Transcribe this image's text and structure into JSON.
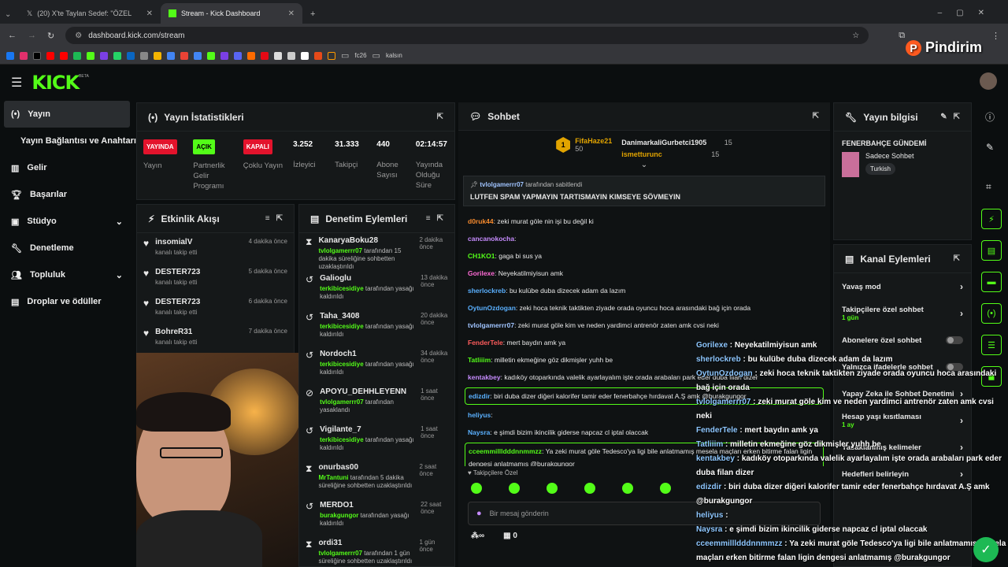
{
  "browser": {
    "tabs": [
      {
        "label": "(20) X'te Taylan Sedef: \"ÖZEL İ"
      },
      {
        "label": "Stream - Kick Dashboard"
      }
    ],
    "url": "dashboard.kick.com/stream",
    "bookmarks": [
      "fc26",
      "kalsın"
    ],
    "watermark": "Pindirim"
  },
  "app": {
    "logo": "KICK",
    "logo_badge": "BETA"
  },
  "sidebar": {
    "items": [
      {
        "label": "Yayın"
      },
      {
        "label": "Yayın Bağlantısı ve Anahtarı"
      },
      {
        "label": "Gelir"
      },
      {
        "label": "Başarılar"
      },
      {
        "label": "Stüdyo"
      },
      {
        "label": "Denetleme"
      },
      {
        "label": "Topluluk"
      },
      {
        "label": "Droplar ve ödüller"
      }
    ]
  },
  "stats": {
    "title": "Yayın İstatistikleri",
    "items": [
      {
        "badge": "YAYINDA",
        "label": "Yayın"
      },
      {
        "badge": "AÇIK",
        "label": "Partnerlik Gelir Programı"
      },
      {
        "badge": "KAPALI",
        "label": "Çoklu Yayın"
      },
      {
        "value": "3.252",
        "label": "İzleyici"
      },
      {
        "value": "31.333",
        "label": "Takipçi"
      },
      {
        "value": "440",
        "label": "Abone Sayısı"
      },
      {
        "value": "02:14:57",
        "label": "Yayında Olduğu Süre"
      }
    ]
  },
  "activity": {
    "title": "Etkinlik Akışı",
    "items": [
      {
        "name": "insomialV",
        "sub": "kanalı takip etti",
        "time": "4 dakika önce"
      },
      {
        "name": "DESTER723",
        "sub": "kanalı takip etti",
        "time": "5 dakika önce"
      },
      {
        "name": "DESTER723",
        "sub": "kanalı takip etti",
        "time": "6 dakika önce"
      },
      {
        "name": "BohreR31",
        "sub": "kanalı takip etti",
        "time": "7 dakika önce"
      }
    ]
  },
  "moderation": {
    "title": "Denetim Eylemleri",
    "items": [
      {
        "name": "KanaryaBoku28",
        "by": "tvlolgamerrr07",
        "rest": "tarafından 15 dakika süreliğine sohbetten uzaklaştırıldı",
        "time": "2 dakika önce"
      },
      {
        "name": "Galioglu",
        "by": "terkibicesidiye",
        "rest": "tarafından yasağı kaldırıldı",
        "time": "13 dakika önce"
      },
      {
        "name": "Taha_3408",
        "by": "terkibicesidiye",
        "rest": "tarafından yasağı kaldırıldı",
        "time": "20 dakika önce"
      },
      {
        "name": "Nordoch1",
        "by": "terkibicesidiye",
        "rest": "tarafından yasağı kaldırıldı",
        "time": "34 dakika önce"
      },
      {
        "name": "APOYU_DEHHLEYENN",
        "by": "tvlolgamerrr07",
        "rest": "tarafından yasaklandı",
        "time": "1 saat önce"
      },
      {
        "name": "Vigilante_7",
        "by": "terkibicesidiye",
        "rest": "tarafından yasağı kaldırıldı",
        "time": "1 saat önce"
      },
      {
        "name": "onurbas00",
        "by": "MrTantuni",
        "rest": "tarafından 5 dakika süreliğine sohbetten uzaklaştırıldı",
        "time": "2 saat önce"
      },
      {
        "name": "MERDO1",
        "by": "burakgungor",
        "rest": "tarafından yasağı kaldırıldı",
        "time": "22 saat önce"
      },
      {
        "name": "ordi31",
        "by": "tvlolgamerrr07",
        "rest": "tarafından 1 gün süreliğine sohbetten uzaklaştırıldı",
        "time": "1 gün önce"
      }
    ]
  },
  "chat": {
    "title": "Sohbet",
    "top": [
      {
        "name": "FifaHaze21",
        "value": "50"
      },
      {
        "name": "DanimarkaliGurbetci1905",
        "value": "15"
      },
      {
        "name": "ismetturunc",
        "value": "15"
      }
    ],
    "pinned": {
      "by": "tvlolgamerrr07",
      "suffix": "tarafından sabitlendi",
      "text": "LUTFEN SPAM YAPMAYIN TARTISMAYIN KIMSEYE SÖVMEYIN"
    },
    "messages": [
      {
        "user": "d0ruk44",
        "text": "zeki murat göle nin işi bu değil ki",
        "color": "#f58a2e"
      },
      {
        "user": "cancanokocha",
        "text": "",
        "color": "#c78cff"
      },
      {
        "user": "CH1KO1",
        "text": "gaga bi sus ya",
        "color": "#53fc18"
      },
      {
        "user": "Gorilexe",
        "text": "Neyekatilmiyisun amk",
        "color": "#ff6bd6"
      },
      {
        "user": "sherlockreb",
        "text": "bu kulübe duba dizecek adam da lazım",
        "color": "#5ab0ff"
      },
      {
        "user": "OytunOzdogan",
        "text": "zeki hoca teknik taktikten ziyade orada oyuncu hoca arasındaki bağ için orada",
        "color": "#5ab0ff"
      },
      {
        "user": "tvlolgamerrr07",
        "text": "zeki murat göle kim ve neden yardimci antrenör zaten amk cvsi neki",
        "color": "#a0c4ff"
      },
      {
        "user": "FenderTele",
        "text": "mert baydın amk ya",
        "color": "#ff5c5c"
      },
      {
        "user": "Tatliiim",
        "text": "milletin ekmeğine göz dikmişler yuhh be",
        "color": "#53fc18"
      },
      {
        "user": "kentakbey",
        "text": "kadıköy otoparkında valelik ayarlayalım işte orada arabaları park eder duba filan dizer",
        "color": "#c78cff"
      },
      {
        "user": "edizdir",
        "text": "biri duba dizer diğeri kalorifer tamir eder fenerbahçe hırdavat A.Ş amk @burakgungor",
        "color": "#5ab0ff"
      },
      {
        "user": "heliyus",
        "text": "",
        "color": "#5ab0ff"
      },
      {
        "user": "Naysra",
        "text": "e şimdi bizim ikincilik giderse napcaz cl iptal olaccak",
        "color": "#5ab0ff"
      },
      {
        "user": "cceemmillldddnnmmzz",
        "text": "Ya zeki murat göle Tedesco'ya ligi bile anlatmamış mesela maçları erken bitirme falan ligin dengesi anlatmamış @burakgungor",
        "color": "#53fc18"
      }
    ],
    "followers_label": "Takipçilere Özel",
    "input_placeholder": "Bir mesaj gönderin",
    "count": "0"
  },
  "overlay": {
    "messages": [
      {
        "user": "Gorilexe",
        "text": "Neyekatilmiyisun amk"
      },
      {
        "user": "sherlockreb",
        "text": "bu kulübe duba dizecek adam da lazım"
      },
      {
        "user": "OytunOzdogan",
        "text": "zeki hoca teknik taktikten ziyade orada oyuncu hoca arasındaki bağ için orada"
      },
      {
        "user": "tvlolgamerrr07",
        "text": "zeki murat göle kim ve neden yardimci antrenör zaten amk cvsi neki"
      },
      {
        "user": "FenderTele",
        "text": "mert baydın amk ya"
      },
      {
        "user": "Tatliiim",
        "text": "milletin ekmeğine göz dikmişler yuhh be"
      },
      {
        "user": "kentakbey",
        "text": "kadıköy otoparkında valelik ayarlayalım işte orada arabaları park eder duba filan dizer"
      },
      {
        "user": "edizdir",
        "text": "biri duba dizer diğeri kalorifer tamir eder fenerbahçe hırdavat A.Ş amk @burakgungor"
      },
      {
        "user": "heliyus",
        "text": ""
      },
      {
        "user": "Naysra",
        "text": "e şimdi bizim ikincilik giderse napcaz cl iptal olaccak"
      },
      {
        "user": "cceemmillldddnnmmzz",
        "text": "Ya zeki murat göle Tedesco'ya ligi bile anlatmamış mesela maçları erken bitirme falan ligin dengesi anlatmamış @burakgungor"
      }
    ]
  },
  "info": {
    "title": "Yayın bilgisi",
    "stream_title": "FENERBAHÇE GÜNDEMİ",
    "category": "Sadece Sohbet",
    "tag": "Turkish"
  },
  "channel": {
    "title": "Kanal Eylemleri",
    "items": [
      {
        "label": "Yavaş mod"
      },
      {
        "label": "Takipçilere özel sohbet",
        "sub": "1 gün"
      },
      {
        "label": "Abonelere özel sohbet"
      },
      {
        "label": "Yalnızca ifadelerle sohbet"
      },
      {
        "label": "Yapay Zeka ile Sohbet Denetimi"
      },
      {
        "label": "Hesap yaşı kısıtlaması",
        "sub": "1 ay"
      },
      {
        "label": "Yasaklanmış kelimeler"
      },
      {
        "label": "Hedefleri belirleyin"
      }
    ]
  }
}
